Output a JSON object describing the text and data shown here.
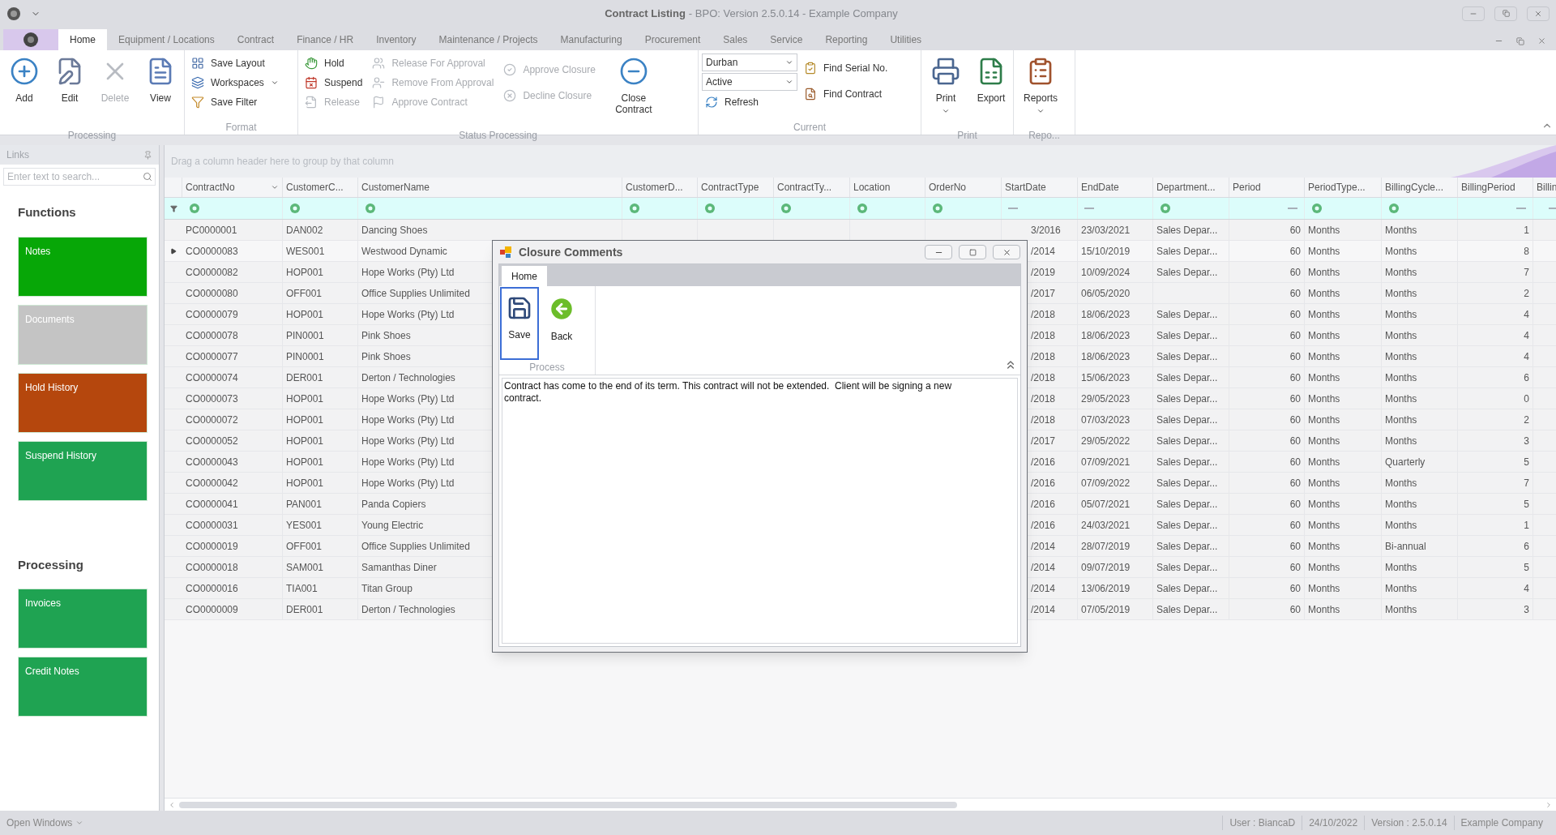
{
  "window": {
    "title": "Contract Listing",
    "subtitle": "- BPO: Version 2.5.0.14 - Example Company"
  },
  "ribbon_tabs": [
    {
      "label": "Home",
      "selected": true
    },
    {
      "label": "Equipment / Locations",
      "selected": false
    },
    {
      "label": "Contract",
      "selected": false
    },
    {
      "label": "Finance / HR",
      "selected": false
    },
    {
      "label": "Inventory",
      "selected": false
    },
    {
      "label": "Maintenance / Projects",
      "selected": false
    },
    {
      "label": "Manufacturing",
      "selected": false
    },
    {
      "label": "Procurement",
      "selected": false
    },
    {
      "label": "Sales",
      "selected": false
    },
    {
      "label": "Service",
      "selected": false
    },
    {
      "label": "Reporting",
      "selected": false
    },
    {
      "label": "Utilities",
      "selected": false
    }
  ],
  "ribbon_groups": [
    {
      "label": "Processing",
      "columns": [
        [
          {
            "kind": "large",
            "label": "Add",
            "disabled": false
          }
        ],
        [
          {
            "kind": "large",
            "label": "Edit",
            "disabled": false
          }
        ],
        [
          {
            "kind": "large",
            "label": "Delete",
            "disabled": true
          }
        ],
        [
          {
            "kind": "large",
            "label": "View",
            "disabled": false
          }
        ]
      ]
    },
    {
      "label": "Format",
      "columns": [
        [
          {
            "kind": "small",
            "label": "Save Layout",
            "disabled": false
          },
          {
            "kind": "small",
            "label": "Workspaces",
            "disabled": false,
            "has_menu": true
          },
          {
            "kind": "small",
            "label": "Save Filter",
            "disabled": false
          }
        ]
      ]
    },
    {
      "label": "Status Processing",
      "columns": [
        [
          {
            "kind": "small",
            "label": "Hold",
            "disabled": false
          },
          {
            "kind": "small",
            "label": "Suspend",
            "disabled": false
          },
          {
            "kind": "small",
            "label": "Release",
            "disabled": true
          }
        ],
        [
          {
            "kind": "small",
            "label": "Release For Approval",
            "disabled": true
          },
          {
            "kind": "small",
            "label": "Remove From Approval",
            "disabled": true
          },
          {
            "kind": "small",
            "label": "Approve Contract",
            "disabled": true
          }
        ],
        [
          {
            "kind": "small",
            "label": "Approve Closure",
            "disabled": true
          },
          {
            "kind": "small",
            "label": "Decline Closure",
            "disabled": true
          }
        ],
        [
          {
            "kind": "large",
            "label": "Close Contract",
            "disabled": false
          }
        ]
      ]
    },
    {
      "label": "Current",
      "columns": [
        [
          {
            "kind": "dropdown",
            "label": "Durban"
          },
          {
            "kind": "dropdown",
            "label": "Active"
          },
          {
            "kind": "small",
            "label": "Refresh",
            "disabled": false
          }
        ],
        [
          {
            "kind": "small",
            "label": "Find Serial No.",
            "disabled": false
          },
          {
            "kind": "small",
            "label": "Find Contract",
            "disabled": false
          }
        ]
      ]
    },
    {
      "label": "Print",
      "columns": [
        [
          {
            "kind": "large",
            "label": "Print",
            "disabled": false,
            "has_menu": true
          }
        ],
        [
          {
            "kind": "large",
            "label": "Export",
            "disabled": false
          }
        ]
      ]
    },
    {
      "label": "Repo...",
      "columns": [
        [
          {
            "kind": "large",
            "label": "Reports",
            "disabled": false,
            "has_menu": true
          }
        ]
      ]
    }
  ],
  "links": {
    "title": "Links",
    "search_placeholder": "Enter text to search...",
    "sections": [
      {
        "title": "Functions",
        "tiles": [
          {
            "label": "Notes",
            "color": "#07a707"
          },
          {
            "label": "Documents",
            "color": "#c4c4c4"
          },
          {
            "label": "Hold History",
            "color": "#b5470d"
          },
          {
            "label": "Suspend History",
            "color": "#1fa352"
          }
        ]
      },
      {
        "title": "Processing",
        "tiles": [
          {
            "label": "Invoices",
            "color": "#1fa352"
          },
          {
            "label": "Credit Notes",
            "color": "#1fa352"
          }
        ]
      }
    ]
  },
  "grid": {
    "group_panel": "Drag a column header here to group by that column",
    "columns": [
      {
        "label": "ContractNo",
        "kind": "text"
      },
      {
        "label": "CustomerC...",
        "kind": "text"
      },
      {
        "label": "CustomerName",
        "kind": "text"
      },
      {
        "label": "CustomerD...",
        "kind": "text"
      },
      {
        "label": "ContractType",
        "kind": "text"
      },
      {
        "label": "ContractTy...",
        "kind": "text"
      },
      {
        "label": "Location",
        "kind": "text"
      },
      {
        "label": "OrderNo",
        "kind": "text"
      },
      {
        "label": "StartDate",
        "kind": "date"
      },
      {
        "label": "EndDate",
        "kind": "date"
      },
      {
        "label": "Department...",
        "kind": "text"
      },
      {
        "label": "Period",
        "kind": "number"
      },
      {
        "label": "PeriodType...",
        "kind": "text"
      },
      {
        "label": "BillingCycle...",
        "kind": "text"
      },
      {
        "label": "BillingPeriod",
        "kind": "number"
      },
      {
        "label": "Billin",
        "kind": "number"
      }
    ],
    "rows": [
      {
        "contract_no": "PC0000001",
        "customer_code": "DAN002",
        "customer_name": "Dancing Shoes",
        "start_date": "3/2016",
        "end_date": "23/03/2021",
        "department": "Sales Depar...",
        "period": "60",
        "period_type": "Months",
        "billing_cycle": "Months",
        "billing_period": "1",
        "current": false
      },
      {
        "contract_no": "CO0000083",
        "customer_code": "WES001",
        "customer_name": "Westwood Dynamic",
        "start_date": "/2014",
        "end_date": "15/10/2019",
        "department": "Sales Depar...",
        "period": "60",
        "period_type": "Months",
        "billing_cycle": "Months",
        "billing_period": "8",
        "current": true
      },
      {
        "contract_no": "CO0000082",
        "customer_code": "HOP001",
        "customer_name": "Hope Works (Pty) Ltd",
        "start_date": "/2019",
        "end_date": "10/09/2024",
        "department": "Sales Depar...",
        "period": "60",
        "period_type": "Months",
        "billing_cycle": "Months",
        "billing_period": "7",
        "current": false
      },
      {
        "contract_no": "CO0000080",
        "customer_code": "OFF001",
        "customer_name": "Office Supplies Unlimited",
        "start_date": "/2017",
        "end_date": "06/05/2020",
        "period": "60",
        "period_type": "Months",
        "billing_cycle": "Months",
        "billing_period": "2",
        "current": false
      },
      {
        "contract_no": "CO0000079",
        "customer_code": "HOP001",
        "customer_name": "Hope Works (Pty) Ltd",
        "start_date": "/2018",
        "end_date": "18/06/2023",
        "department": "Sales Depar...",
        "period": "60",
        "period_type": "Months",
        "billing_cycle": "Months",
        "billing_period": "4",
        "current": false
      },
      {
        "contract_no": "CO0000078",
        "customer_code": "PIN0001",
        "customer_name": "Pink Shoes",
        "start_date": "/2018",
        "end_date": "18/06/2023",
        "department": "Sales Depar...",
        "period": "60",
        "period_type": "Months",
        "billing_cycle": "Months",
        "billing_period": "4",
        "current": false
      },
      {
        "contract_no": "CO0000077",
        "customer_code": "PIN0001",
        "customer_name": "Pink Shoes",
        "start_date": "/2018",
        "end_date": "18/06/2023",
        "department": "Sales Depar...",
        "period": "60",
        "period_type": "Months",
        "billing_cycle": "Months",
        "billing_period": "4",
        "current": false
      },
      {
        "contract_no": "CO0000074",
        "customer_code": "DER001",
        "customer_name": "Derton / Technologies",
        "start_date": "/2018",
        "end_date": "15/06/2023",
        "department": "Sales Depar...",
        "period": "60",
        "period_type": "Months",
        "billing_cycle": "Months",
        "billing_period": "6",
        "current": false
      },
      {
        "contract_no": "CO0000073",
        "customer_code": "HOP001",
        "customer_name": "Hope Works (Pty) Ltd",
        "start_date": "/2018",
        "end_date": "29/05/2023",
        "department": "Sales Depar...",
        "period": "60",
        "period_type": "Months",
        "billing_cycle": "Months",
        "billing_period": "0",
        "current": false
      },
      {
        "contract_no": "CO0000072",
        "customer_code": "HOP001",
        "customer_name": "Hope Works (Pty) Ltd",
        "start_date": "/2018",
        "end_date": "07/03/2023",
        "department": "Sales Depar...",
        "period": "60",
        "period_type": "Months",
        "billing_cycle": "Months",
        "billing_period": "2",
        "current": false
      },
      {
        "contract_no": "CO0000052",
        "customer_code": "HOP001",
        "customer_name": "Hope Works (Pty) Ltd",
        "start_date": "/2017",
        "end_date": "29/05/2022",
        "department": "Sales Depar...",
        "period": "60",
        "period_type": "Months",
        "billing_cycle": "Months",
        "billing_period": "3",
        "current": false
      },
      {
        "contract_no": "CO0000043",
        "customer_code": "HOP001",
        "customer_name": "Hope Works (Pty) Ltd",
        "start_date": "/2016",
        "end_date": "07/09/2021",
        "department": "Sales Depar...",
        "period": "60",
        "period_type": "Months",
        "billing_cycle": "Quarterly",
        "billing_period": "5",
        "current": false
      },
      {
        "contract_no": "CO0000042",
        "customer_code": "HOP001",
        "customer_name": "Hope Works (Pty) Ltd",
        "start_date": "/2016",
        "end_date": "07/09/2022",
        "department": "Sales Depar...",
        "period": "60",
        "period_type": "Months",
        "billing_cycle": "Months",
        "billing_period": "7",
        "current": false
      },
      {
        "contract_no": "CO0000041",
        "customer_code": "PAN001",
        "customer_name": "Panda Copiers",
        "start_date": "/2016",
        "end_date": "05/07/2021",
        "department": "Sales Depar...",
        "period": "60",
        "period_type": "Months",
        "billing_cycle": "Months",
        "billing_period": "5",
        "current": false
      },
      {
        "contract_no": "CO0000031",
        "customer_code": "YES001",
        "customer_name": "Young Electric",
        "start_date": "/2016",
        "end_date": "24/03/2021",
        "department": "Sales Depar...",
        "period": "60",
        "period_type": "Months",
        "billing_cycle": "Months",
        "billing_period": "1",
        "current": false
      },
      {
        "contract_no": "CO0000019",
        "customer_code": "OFF001",
        "customer_name": "Office Supplies Unlimited",
        "start_date": "/2014",
        "end_date": "28/07/2019",
        "department": "Sales Depar...",
        "period": "60",
        "period_type": "Months",
        "billing_cycle": "Bi-annual",
        "billing_period": "6",
        "current": false
      },
      {
        "contract_no": "CO0000018",
        "customer_code": "SAM001",
        "customer_name": "Samanthas Diner",
        "start_date": "/2014",
        "end_date": "09/07/2019",
        "department": "Sales Depar...",
        "period": "60",
        "period_type": "Months",
        "billing_cycle": "Months",
        "billing_period": "5",
        "current": false
      },
      {
        "contract_no": "CO0000016",
        "customer_code": "TIA001",
        "customer_name": "Titan Group",
        "start_date": "/2014",
        "end_date": "13/06/2019",
        "department": "Sales Depar...",
        "period": "60",
        "period_type": "Months",
        "billing_cycle": "Months",
        "billing_period": "4",
        "current": false
      },
      {
        "contract_no": "CO0000009",
        "customer_code": "DER001",
        "customer_name": "Derton / Technologies",
        "start_date": "/2014",
        "end_date": "07/05/2019",
        "department": "Sales Depar...",
        "period": "60",
        "period_type": "Months",
        "billing_cycle": "Months",
        "billing_period": "3",
        "current": false
      }
    ]
  },
  "dialog": {
    "title": "Closure Comments",
    "tabs": [
      {
        "label": "Home",
        "selected": true
      }
    ],
    "buttons": [
      {
        "label": "Save",
        "focused": true
      },
      {
        "label": "Back",
        "focused": false
      }
    ],
    "group_label": "Process",
    "comment": "Contract has come to the end of its term. This contract will not be extended.  Client will be signing a new contract."
  },
  "status_bar": {
    "open_windows": "Open Windows",
    "items": [
      "User : BiancaD",
      "24/10/2022",
      "Version : 2.5.0.14",
      "Example Company"
    ]
  }
}
